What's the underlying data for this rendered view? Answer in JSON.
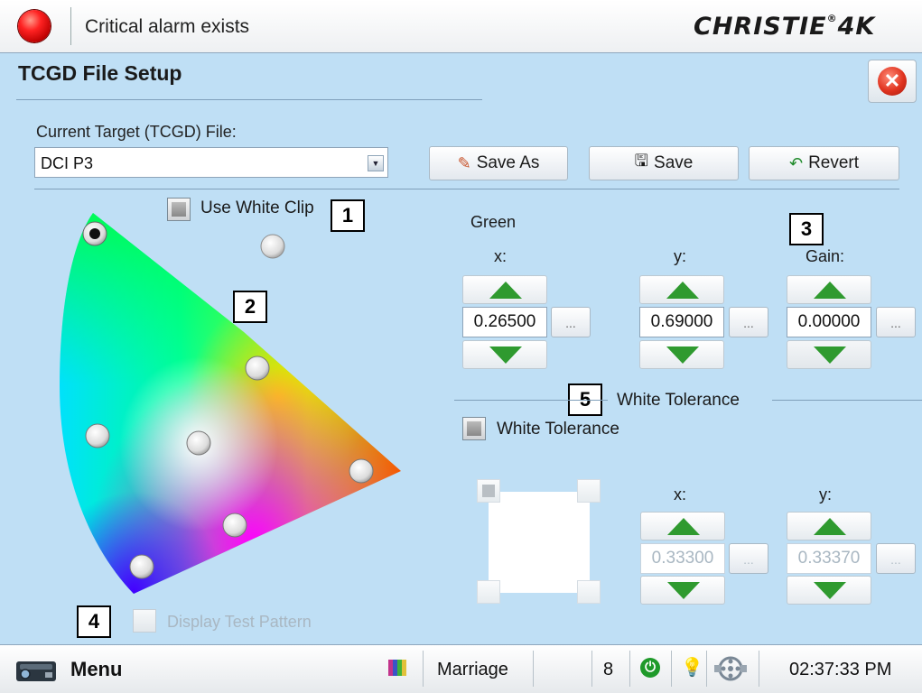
{
  "header": {
    "alarm_text": "Critical alarm exists",
    "logo": "CHRISTIE 4K",
    "status_color": "#e01b1b"
  },
  "page": {
    "title": "TCGD File Setup",
    "close_icon": "close-icon"
  },
  "file": {
    "label": "Current Target (TCGD) File:",
    "selected": "DCI P3"
  },
  "toolbar": {
    "save_as_label": "Save As",
    "save_label": "Save",
    "revert_label": "Revert"
  },
  "gamut": {
    "use_white_clip_label": "Use White Clip",
    "use_white_clip_checked": false,
    "display_test_pattern_label": "Display Test Pattern",
    "display_test_pattern_checked": false,
    "selected_point": "Green"
  },
  "callouts": [
    "1",
    "2",
    "3",
    "4",
    "5"
  ],
  "color_point": {
    "name": "Green",
    "x_label": "x:",
    "y_label": "y:",
    "gain_label": "Gain:",
    "x_value": "0.26500",
    "y_value": "0.69000",
    "gain_value": "0.00000",
    "ellipsis": "..."
  },
  "white_tolerance": {
    "section_label": "White Tolerance",
    "checkbox_label": "White Tolerance",
    "checked": false,
    "x_label": "x:",
    "y_label": "y:",
    "x_value": "0.33300",
    "y_value": "0.33370",
    "ellipsis": "..."
  },
  "statusbar": {
    "menu_label": "Menu",
    "channel": "Marriage",
    "count": "8",
    "time": "02:37:33 PM",
    "icons": [
      "projector-icon",
      "test-pattern-icon",
      "power-icon",
      "lamp-icon",
      "film-reel-icon"
    ],
    "power_color": "#1f9a2a"
  }
}
